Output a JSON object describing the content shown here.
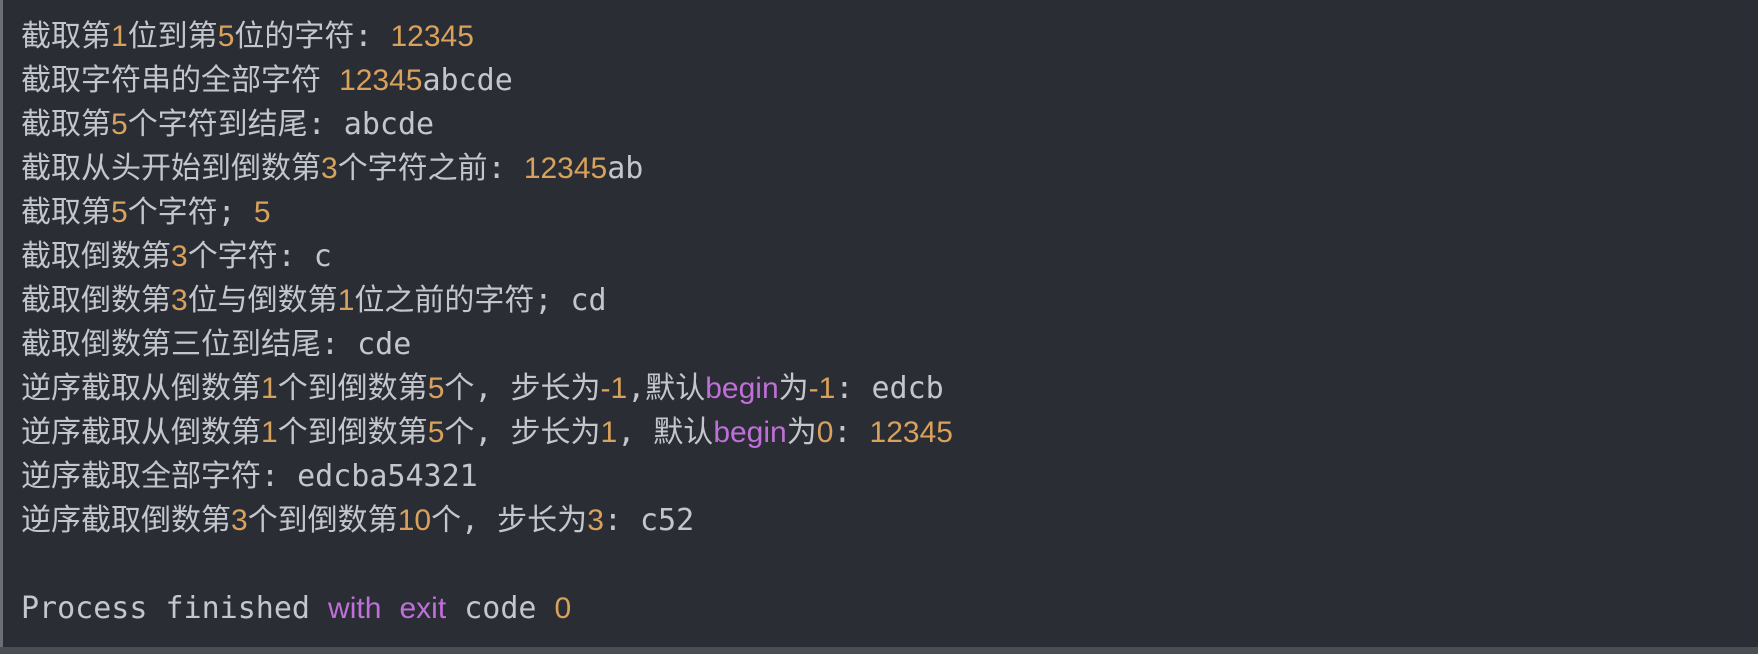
{
  "console": {
    "lines": [
      {
        "id": "line-1",
        "segments": [
          {
            "t": "截取第",
            "c": "text"
          },
          {
            "t": "1",
            "c": "num"
          },
          {
            "t": "位到第",
            "c": "text"
          },
          {
            "t": "5",
            "c": "num"
          },
          {
            "t": "位的字符: ",
            "c": "text"
          },
          {
            "t": "12345",
            "c": "num"
          }
        ]
      },
      {
        "id": "line-2",
        "segments": [
          {
            "t": "截取字符串的全部字符 ",
            "c": "text"
          },
          {
            "t": "12345",
            "c": "num"
          },
          {
            "t": "abcde",
            "c": "text"
          }
        ]
      },
      {
        "id": "line-3",
        "segments": [
          {
            "t": "截取第",
            "c": "text"
          },
          {
            "t": "5",
            "c": "num"
          },
          {
            "t": "个字符到结尾: abcde",
            "c": "text"
          }
        ]
      },
      {
        "id": "line-4",
        "segments": [
          {
            "t": "截取从头开始到倒数第",
            "c": "text"
          },
          {
            "t": "3",
            "c": "num"
          },
          {
            "t": "个字符之前: ",
            "c": "text"
          },
          {
            "t": "12345",
            "c": "num"
          },
          {
            "t": "ab",
            "c": "text"
          }
        ]
      },
      {
        "id": "line-5",
        "segments": [
          {
            "t": "截取第",
            "c": "text"
          },
          {
            "t": "5",
            "c": "num"
          },
          {
            "t": "个字符; ",
            "c": "text"
          },
          {
            "t": "5",
            "c": "num"
          }
        ]
      },
      {
        "id": "line-6",
        "segments": [
          {
            "t": "截取倒数第",
            "c": "text"
          },
          {
            "t": "3",
            "c": "num"
          },
          {
            "t": "个字符: c",
            "c": "text"
          }
        ]
      },
      {
        "id": "line-7",
        "segments": [
          {
            "t": "截取倒数第",
            "c": "text"
          },
          {
            "t": "3",
            "c": "num"
          },
          {
            "t": "位与倒数第",
            "c": "text"
          },
          {
            "t": "1",
            "c": "num"
          },
          {
            "t": "位之前的字符; cd",
            "c": "text"
          }
        ]
      },
      {
        "id": "line-8",
        "segments": [
          {
            "t": "截取倒数第三位到结尾: cde",
            "c": "text"
          }
        ]
      },
      {
        "id": "line-9",
        "segments": [
          {
            "t": "逆序截取从倒数第",
            "c": "text"
          },
          {
            "t": "1",
            "c": "num"
          },
          {
            "t": "个到倒数第",
            "c": "text"
          },
          {
            "t": "5",
            "c": "num"
          },
          {
            "t": "个, 步长为",
            "c": "text"
          },
          {
            "t": "-1",
            "c": "num"
          },
          {
            "t": ",默认",
            "c": "text"
          },
          {
            "t": "begin",
            "c": "kw"
          },
          {
            "t": "为",
            "c": "text"
          },
          {
            "t": "-1",
            "c": "num"
          },
          {
            "t": ": edcb",
            "c": "text"
          }
        ]
      },
      {
        "id": "line-10",
        "segments": [
          {
            "t": "逆序截取从倒数第",
            "c": "text"
          },
          {
            "t": "1",
            "c": "num"
          },
          {
            "t": "个到倒数第",
            "c": "text"
          },
          {
            "t": "5",
            "c": "num"
          },
          {
            "t": "个, 步长为",
            "c": "text"
          },
          {
            "t": "1",
            "c": "num"
          },
          {
            "t": ", 默认",
            "c": "text"
          },
          {
            "t": "begin",
            "c": "kw"
          },
          {
            "t": "为",
            "c": "text"
          },
          {
            "t": "0",
            "c": "num"
          },
          {
            "t": ": ",
            "c": "text"
          },
          {
            "t": "12345",
            "c": "num"
          }
        ]
      },
      {
        "id": "line-11",
        "segments": [
          {
            "t": "逆序截取全部字符: edcba54321",
            "c": "text"
          }
        ]
      },
      {
        "id": "line-12",
        "segments": [
          {
            "t": "逆序截取倒数第",
            "c": "text"
          },
          {
            "t": "3",
            "c": "num"
          },
          {
            "t": "个到倒数第",
            "c": "text"
          },
          {
            "t": "10",
            "c": "num"
          },
          {
            "t": "个, 步长为",
            "c": "text"
          },
          {
            "t": "3",
            "c": "num"
          },
          {
            "t": ": c52",
            "c": "text"
          }
        ]
      },
      {
        "id": "blank-line",
        "segments": []
      },
      {
        "id": "process-finished",
        "segments": [
          {
            "t": "Process finished ",
            "c": "text"
          },
          {
            "t": "with",
            "c": "kw"
          },
          {
            "t": " ",
            "c": "text"
          },
          {
            "t": "exit",
            "c": "kw"
          },
          {
            "t": " code ",
            "c": "text"
          },
          {
            "t": "0",
            "c": "num"
          }
        ]
      }
    ]
  },
  "colors": {
    "background": "#2b2d35",
    "text": "#c3c6cb",
    "number": "#d9a25c",
    "keyword": "#bf6fd8"
  }
}
